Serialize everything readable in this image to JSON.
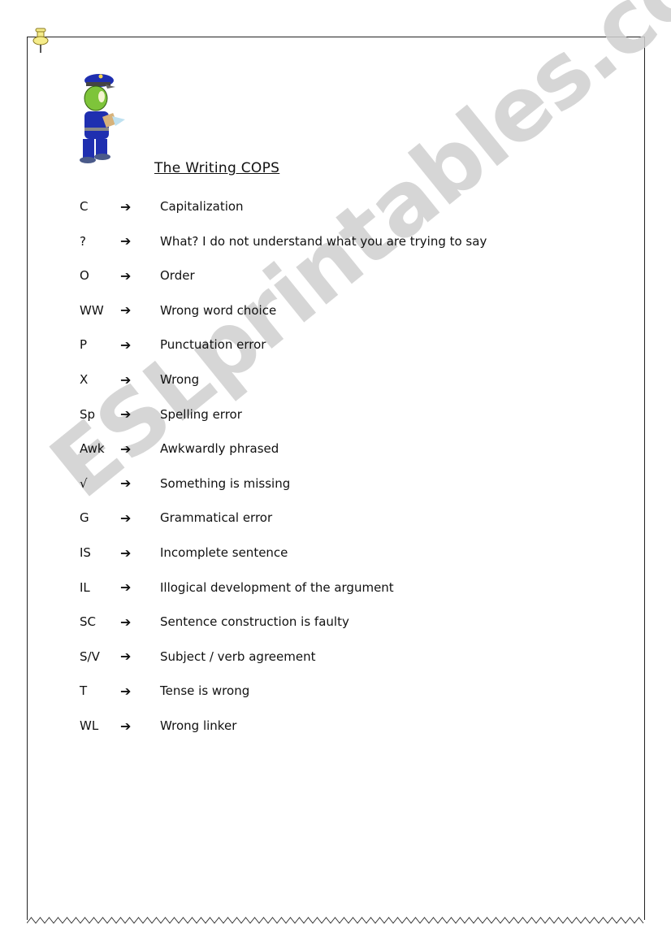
{
  "title": "The Writing COPS",
  "watermark": "ESLprintables.com",
  "colors": {
    "watermark": "#cfcfcf",
    "uniform": "#1f2fb0",
    "skin": "#7ec43a",
    "pin": "#f5ec8a"
  },
  "arrow_glyph": "➔",
  "rows": [
    {
      "code": "C",
      "meaning": "Capitalization"
    },
    {
      "code": "?",
      "meaning": "What? I do not understand what you are trying to say"
    },
    {
      "code": "O",
      "meaning": "Order"
    },
    {
      "code": "WW",
      "meaning": "Wrong word choice"
    },
    {
      "code": "P",
      "meaning": "Punctuation error"
    },
    {
      "code": "X",
      "meaning": "Wrong"
    },
    {
      "code": "Sp",
      "meaning": "Spelling error"
    },
    {
      "code": "Awk",
      "meaning": "Awkwardly phrased"
    },
    {
      "code": "√",
      "meaning": "Something is missing"
    },
    {
      "code": "G",
      "meaning": "Grammatical error"
    },
    {
      "code": "IS",
      "meaning": "Incomplete sentence"
    },
    {
      "code": "IL",
      "meaning": "Illogical development of the argument"
    },
    {
      "code": "SC",
      "meaning": "Sentence construction is faulty"
    },
    {
      "code": "S/V",
      "meaning": "Subject / verb agreement"
    },
    {
      "code": "T",
      "meaning": "Tense is wrong"
    },
    {
      "code": "WL",
      "meaning": "Wrong linker"
    }
  ]
}
